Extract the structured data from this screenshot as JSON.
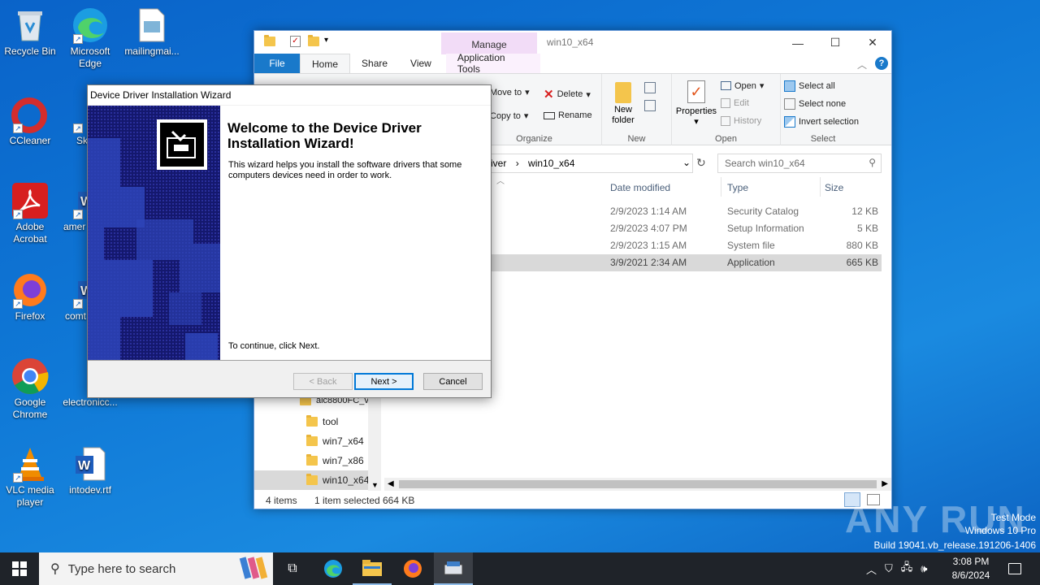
{
  "desktop": {
    "icons": [
      {
        "label": "Recycle Bin",
        "icon": "recycle-bin-icon"
      },
      {
        "label": "Microsoft Edge",
        "icon": "edge-icon"
      },
      {
        "label": "mailingmai...",
        "icon": "image-file-icon"
      },
      {
        "label": "CCleaner",
        "icon": "ccleaner-icon"
      },
      {
        "label": "Sk",
        "icon": "app-icon"
      },
      {
        "label": "Adobe Acrobat",
        "icon": "acrobat-icon"
      },
      {
        "label": "amer",
        "icon": "word-icon"
      },
      {
        "label": "Firefox",
        "icon": "firefox-icon"
      },
      {
        "label": "comt",
        "icon": "word-icon"
      },
      {
        "label": "Google Chrome",
        "icon": "chrome-icon"
      },
      {
        "label": "electronicc...",
        "icon": "file-icon"
      },
      {
        "label": "VLC media player",
        "icon": "vlc-icon"
      },
      {
        "label": "intodev.rtf",
        "icon": "word-icon"
      }
    ]
  },
  "explorer": {
    "title": "win10_x64",
    "contextual_tab": "Manage",
    "tabs": [
      "File",
      "Home",
      "Share",
      "View",
      "Application Tools"
    ],
    "ribbon": {
      "move_to": "Move to",
      "copy_to": "Copy to",
      "delete": "Delete",
      "rename": "Rename",
      "organize": "Organize",
      "new_folder": "New folder",
      "new": "New",
      "properties": "Properties",
      "open": "Open",
      "edit": "Edit",
      "history": "History",
      "open_group": "Open",
      "select_all": "Select all",
      "select_none": "Select none",
      "invert": "Invert selection",
      "select_group": "Select"
    },
    "address": {
      "crumb1": "iver",
      "crumb2": "win10_x64"
    },
    "search_placeholder": "Search win10_x64",
    "columns": {
      "date": "Date modified",
      "type": "Type",
      "size": "Size"
    },
    "rows": [
      {
        "date": "2/9/2023 1:14 AM",
        "type": "Security Catalog",
        "size": "12 KB"
      },
      {
        "date": "2/9/2023 4:07 PM",
        "type": "Setup Information",
        "size": "5 KB"
      },
      {
        "date": "2/9/2023 1:15 AM",
        "type": "System file",
        "size": "880 KB"
      },
      {
        "date": "3/9/2021 2:34 AM",
        "type": "Application",
        "size": "665 KB"
      }
    ],
    "nav": [
      "aic8800FC_v",
      "tool",
      "win7_x64",
      "win7_x86",
      "win10_x64"
    ],
    "status": {
      "count": "4 items",
      "selected": "1 item selected",
      "size": "664 KB"
    }
  },
  "wizard": {
    "title": "Device Driver Installation Wizard",
    "heading": "Welcome to the Device Driver Installation Wizard!",
    "description": "This wizard helps you install the software drivers that some computers devices need in order to work.",
    "continue_text": "To continue, click Next.",
    "back": "< Back",
    "next": "Next >",
    "cancel": "Cancel"
  },
  "taskbar": {
    "search_placeholder": "Type here to search",
    "time": "3:08 PM",
    "date": "8/6/2024"
  },
  "watermark": {
    "mode": "Test Mode",
    "os": "Windows 10 Pro",
    "build": "Build 19041.vb_release.191206-1406",
    "brand": "ANY RUN"
  }
}
